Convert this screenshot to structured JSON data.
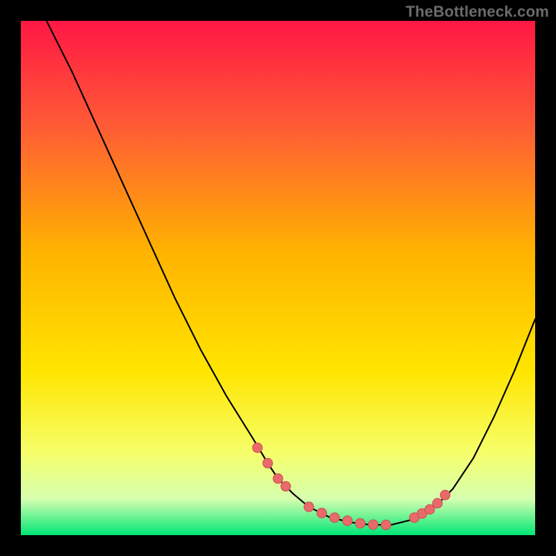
{
  "watermark": "TheBottleneck.com",
  "colors": {
    "background": "#000000",
    "curve": "#000000",
    "dot_fill": "#e86a6a",
    "dot_stroke": "#c94f4f",
    "gradient_stops": [
      {
        "offset": "0%",
        "color": "#ff1744"
      },
      {
        "offset": "20%",
        "color": "#ff5a36"
      },
      {
        "offset": "45%",
        "color": "#ffb300"
      },
      {
        "offset": "68%",
        "color": "#ffe500"
      },
      {
        "offset": "84%",
        "color": "#f6ff6a"
      },
      {
        "offset": "93%",
        "color": "#d6ffb0"
      },
      {
        "offset": "100%",
        "color": "#00e676"
      }
    ]
  },
  "chart_data": {
    "type": "line",
    "title": "",
    "xlabel": "",
    "ylabel": "",
    "xlim": [
      0,
      100
    ],
    "ylim": [
      0,
      100
    ],
    "series": [
      {
        "name": "bottleneck-curve",
        "x": [
          5,
          10,
          15,
          20,
          25,
          30,
          35,
          40,
          45,
          48,
          50,
          53,
          56,
          60,
          64,
          68,
          72,
          76,
          80,
          84,
          88,
          92,
          96,
          100
        ],
        "y": [
          100,
          90,
          79,
          68,
          57,
          46,
          36,
          27,
          19,
          14,
          11,
          8,
          5.5,
          3.5,
          2.5,
          2,
          2,
          3,
          5,
          9,
          15,
          23,
          32,
          42
        ]
      }
    ],
    "markers": {
      "name": "highlight-dots",
      "x": [
        46,
        48,
        50,
        51.5,
        56,
        58.5,
        61,
        63.5,
        66,
        68.5,
        71,
        76.5,
        78,
        79.5,
        81,
        82.5
      ],
      "y": [
        17,
        14,
        11,
        9.5,
        5.5,
        4.3,
        3.4,
        2.8,
        2.3,
        2.05,
        2,
        3.4,
        4.2,
        5,
        6.2,
        7.8
      ]
    }
  }
}
